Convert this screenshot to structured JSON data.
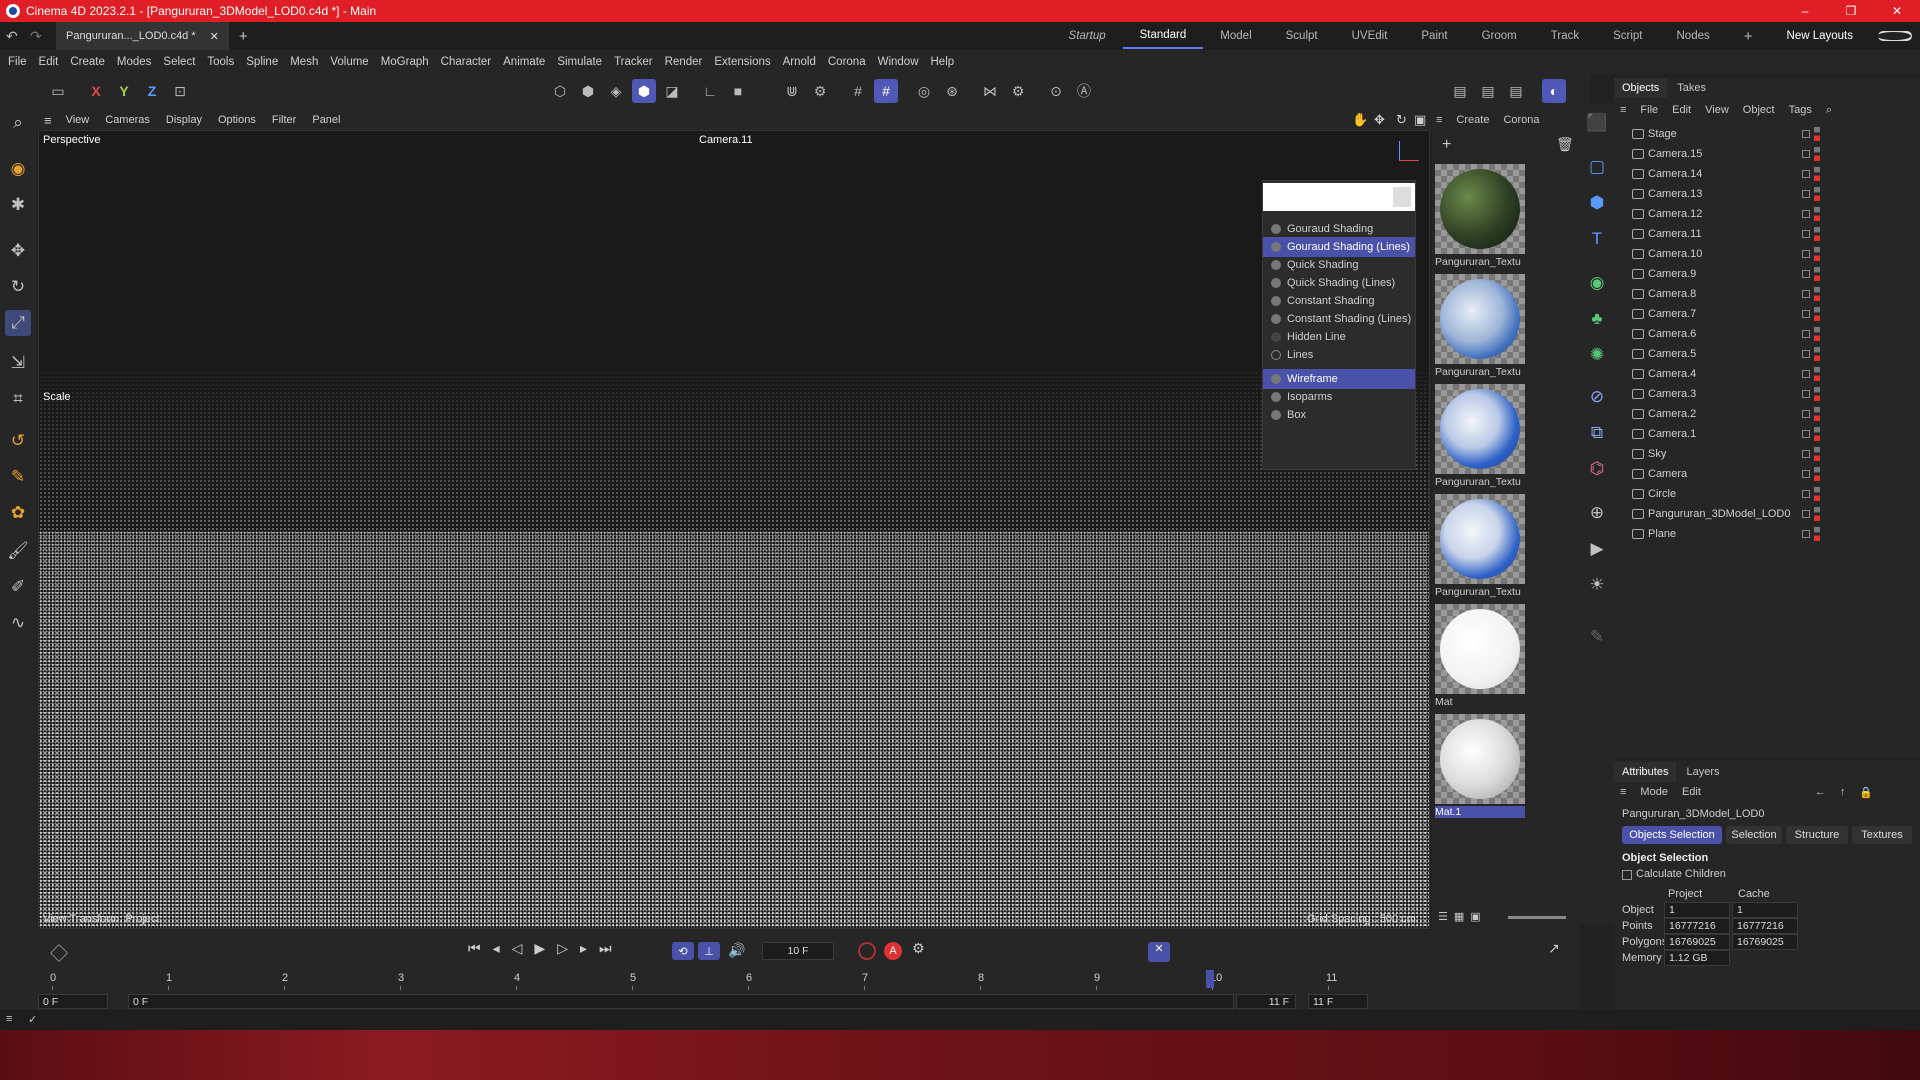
{
  "title": "Cinema 4D 2023.2.1 - [Pangururan_3DModel_LOD0.c4d *] - Main",
  "window_controls": [
    "–",
    "❐",
    "✕"
  ],
  "doc_tab": "Pangururan..._LOD0.c4d *",
  "layouts": [
    "Startup",
    "Standard",
    "Model",
    "Sculpt",
    "UVEdit",
    "Paint",
    "Groom",
    "Track",
    "Script",
    "Nodes"
  ],
  "active_layout": "Standard",
  "new_layouts": "New Layouts",
  "menu": [
    "File",
    "Edit",
    "Create",
    "Modes",
    "Select",
    "Tools",
    "Spline",
    "Mesh",
    "Volume",
    "MoGraph",
    "Character",
    "Animate",
    "Simulate",
    "Tracker",
    "Render",
    "Extensions",
    "Arnold",
    "Corona",
    "Window",
    "Help"
  ],
  "axis_labels": [
    "X",
    "Y",
    "Z"
  ],
  "viewport_menu": [
    "View",
    "Cameras",
    "Display",
    "Options",
    "Filter",
    "Panel"
  ],
  "viewport": {
    "name": "Perspective",
    "camera": "Camera.11",
    "tool": "Scale",
    "bottom_left": "View Transform: Project",
    "bottom_right": "Grid Spacing : 500 cm"
  },
  "shading_menu": [
    {
      "label": "Gouraud Shading",
      "selected": false
    },
    {
      "label": "Gouraud Shading (Lines)",
      "selected": true
    },
    {
      "label": "Quick Shading",
      "selected": false
    },
    {
      "label": "Quick Shading (Lines)",
      "selected": false
    },
    {
      "label": "Constant Shading",
      "selected": false
    },
    {
      "label": "Constant Shading (Lines)",
      "selected": false
    },
    {
      "label": "Hidden Line",
      "selected": false
    },
    {
      "label": "Lines",
      "selected": false
    },
    {
      "label": "Wireframe",
      "selected": true
    },
    {
      "label": "Isoparms",
      "selected": false
    },
    {
      "label": "Box",
      "selected": false
    }
  ],
  "material_menu": [
    "Create",
    "Corona"
  ],
  "materials": [
    {
      "name": "Pangururan_Textu",
      "style": "terrain"
    },
    {
      "name": "Pangururan_Textu",
      "style": "blue"
    },
    {
      "name": "Pangururan_Textu",
      "style": "blue"
    },
    {
      "name": "Pangururan_Textu",
      "style": "blue"
    },
    {
      "name": "Mat",
      "style": "white"
    },
    {
      "name": "Mat.1",
      "style": "grey"
    }
  ],
  "objects_tabs": [
    "Objects",
    "Takes"
  ],
  "objects_menu": [
    "File",
    "Edit",
    "View",
    "Object",
    "Tags"
  ],
  "objects": [
    "Stage",
    "Camera.15",
    "Camera.14",
    "Camera.13",
    "Camera.12",
    "Camera.11",
    "Camera.10",
    "Camera.9",
    "Camera.8",
    "Camera.7",
    "Camera.6",
    "Camera.5",
    "Camera.4",
    "Camera.3",
    "Camera.2",
    "Camera.1",
    "Sky",
    "Camera",
    "Circle",
    "Pangururan_3DModel_LOD0",
    "Plane"
  ],
  "attributes": {
    "tabs": [
      "Attributes",
      "Layers"
    ],
    "menu": [
      "Mode",
      "Edit"
    ],
    "object_name": "Pangururan_3DModel_LOD0",
    "subtabs": [
      "Objects Selection",
      "Selection",
      "Structure",
      "Textures"
    ],
    "section": "Object Selection",
    "checkbox": "Calculate Children",
    "col_project": "Project",
    "col_cache": "Cache",
    "rows": [
      {
        "label": "Object",
        "project": "1",
        "cache": "1"
      },
      {
        "label": "Points",
        "project": "16777216",
        "cache": "16777216"
      },
      {
        "label": "Polygons",
        "project": "16769025",
        "cache": "16769025"
      },
      {
        "label": "Memory",
        "project": "1.12 GB",
        "cache": ""
      }
    ]
  },
  "timeline": {
    "frame": "10 F",
    "ticks": [
      "0",
      "1",
      "2",
      "3",
      "4",
      "5",
      "6",
      "7",
      "8",
      "9",
      "10",
      "11"
    ],
    "start": "0 F",
    "start2": "0 F",
    "end": "11 F",
    "end2": "11 F",
    "current_frame": 10
  },
  "colors": {
    "titlebar": "#e01e25",
    "accent": "#4a51a8"
  }
}
